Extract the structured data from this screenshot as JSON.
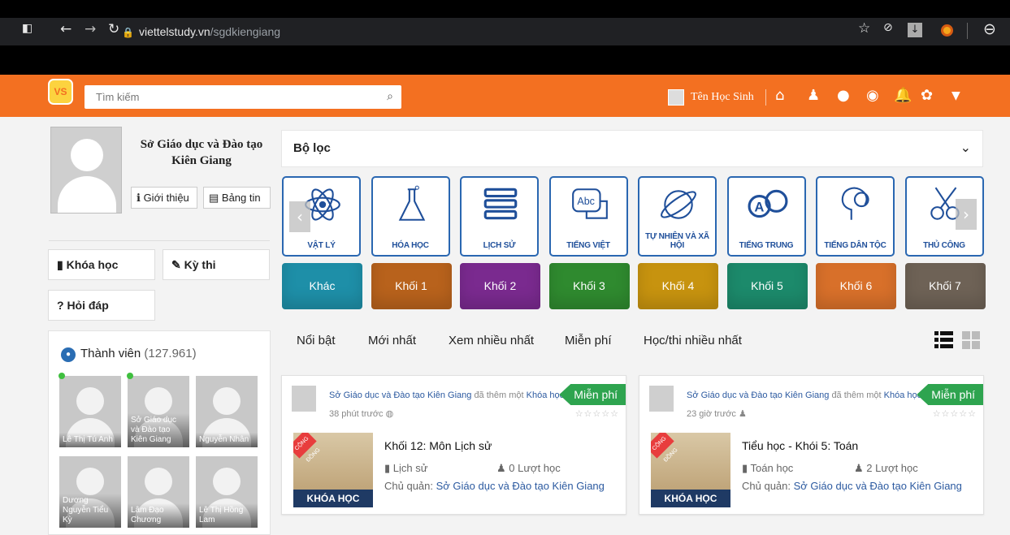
{
  "browser": {
    "domain": "viettelstudy.vn",
    "path": "/sgdkiengiang"
  },
  "header": {
    "logo": "VS",
    "search_placeholder": "Tìm kiếm",
    "student_name": "Tên Học Sinh"
  },
  "profile": {
    "name": "Sở Giáo dục và Đào tạo Kiên Giang",
    "intro_label": "Giới thiệu",
    "news_label": "Bảng tin"
  },
  "left_nav": {
    "courses": "Khóa học",
    "exams": "Kỳ thi",
    "qa": "? Hỏi đáp"
  },
  "members": {
    "title": "Thành viên",
    "count": "(127.961)",
    "list": [
      {
        "name": "Lê Thị Tú Anh",
        "online": true
      },
      {
        "name": "Sở Giáo dục và Đào tạo Kiên Giang",
        "online": true
      },
      {
        "name": "Nguyễn Nhân",
        "online": false
      },
      {
        "name": "Dương Nguyễn Tiểu Kỳ",
        "online": false
      },
      {
        "name": "Lâm Đạo Chương",
        "online": false
      },
      {
        "name": "Lê Thị Hồng Lam",
        "online": false
      }
    ]
  },
  "filter": {
    "title": "Bộ lọc"
  },
  "subjects": [
    "VẬT LÝ",
    "HÓA HỌC",
    "LỊCH SỬ",
    "TIẾNG VIỆT",
    "TỰ NHIÊN VÀ XÃ HỘI",
    "TIẾNG TRUNG",
    "TIẾNG DÂN TỘC",
    "THỦ CÔNG"
  ],
  "grades": [
    {
      "label": "Khác",
      "color": "#1e8fa8"
    },
    {
      "label": "Khối 1",
      "color": "#b8621c"
    },
    {
      "label": "Khối 2",
      "color": "#7a2a8f"
    },
    {
      "label": "Khối 3",
      "color": "#2f8a2f"
    },
    {
      "label": "Khối 4",
      "color": "#c7930f"
    },
    {
      "label": "Khối 5",
      "color": "#1c8a6b"
    },
    {
      "label": "Khối 6",
      "color": "#d8702a"
    },
    {
      "label": "Khối 7",
      "color": "#6e6256"
    }
  ],
  "tabs": [
    "Nổi bật",
    "Mới nhất",
    "Xem nhiều nhất",
    "Miễn phí",
    "Học/thi nhiều nhất"
  ],
  "courses": [
    {
      "author": "Sở Giáo dục và Đào tạo Kiên Giang",
      "action": "đã thêm một",
      "object": "Khóa học",
      "time": "38 phút trước",
      "badge": "Miễn phí",
      "thumb_label": "KHÓA HỌC",
      "thumb_tag": "CỘNG ĐỒNG",
      "title": "Khối 12: Môn Lịch sử",
      "subject": "Lịch sử",
      "views": "0 Lượt học",
      "owner_label": "Chủ quản:",
      "owner": "Sở Giáo dục và Đào tạo Kiên Giang"
    },
    {
      "author": "Sở Giáo dục và Đào tạo Kiên Giang",
      "action": "đã thêm một",
      "object": "Khóa học",
      "time": "23 giờ trước",
      "badge": "Miễn phí",
      "thumb_label": "KHÓA HỌC",
      "thumb_tag": "CỘNG ĐỒNG",
      "title": "Tiểu học - Khói 5: Toán",
      "subject": "Toán học",
      "views": "2 Lượt học",
      "owner_label": "Chủ quản:",
      "owner": "Sở Giáo dục và Đào tạo Kiên Giang"
    }
  ]
}
